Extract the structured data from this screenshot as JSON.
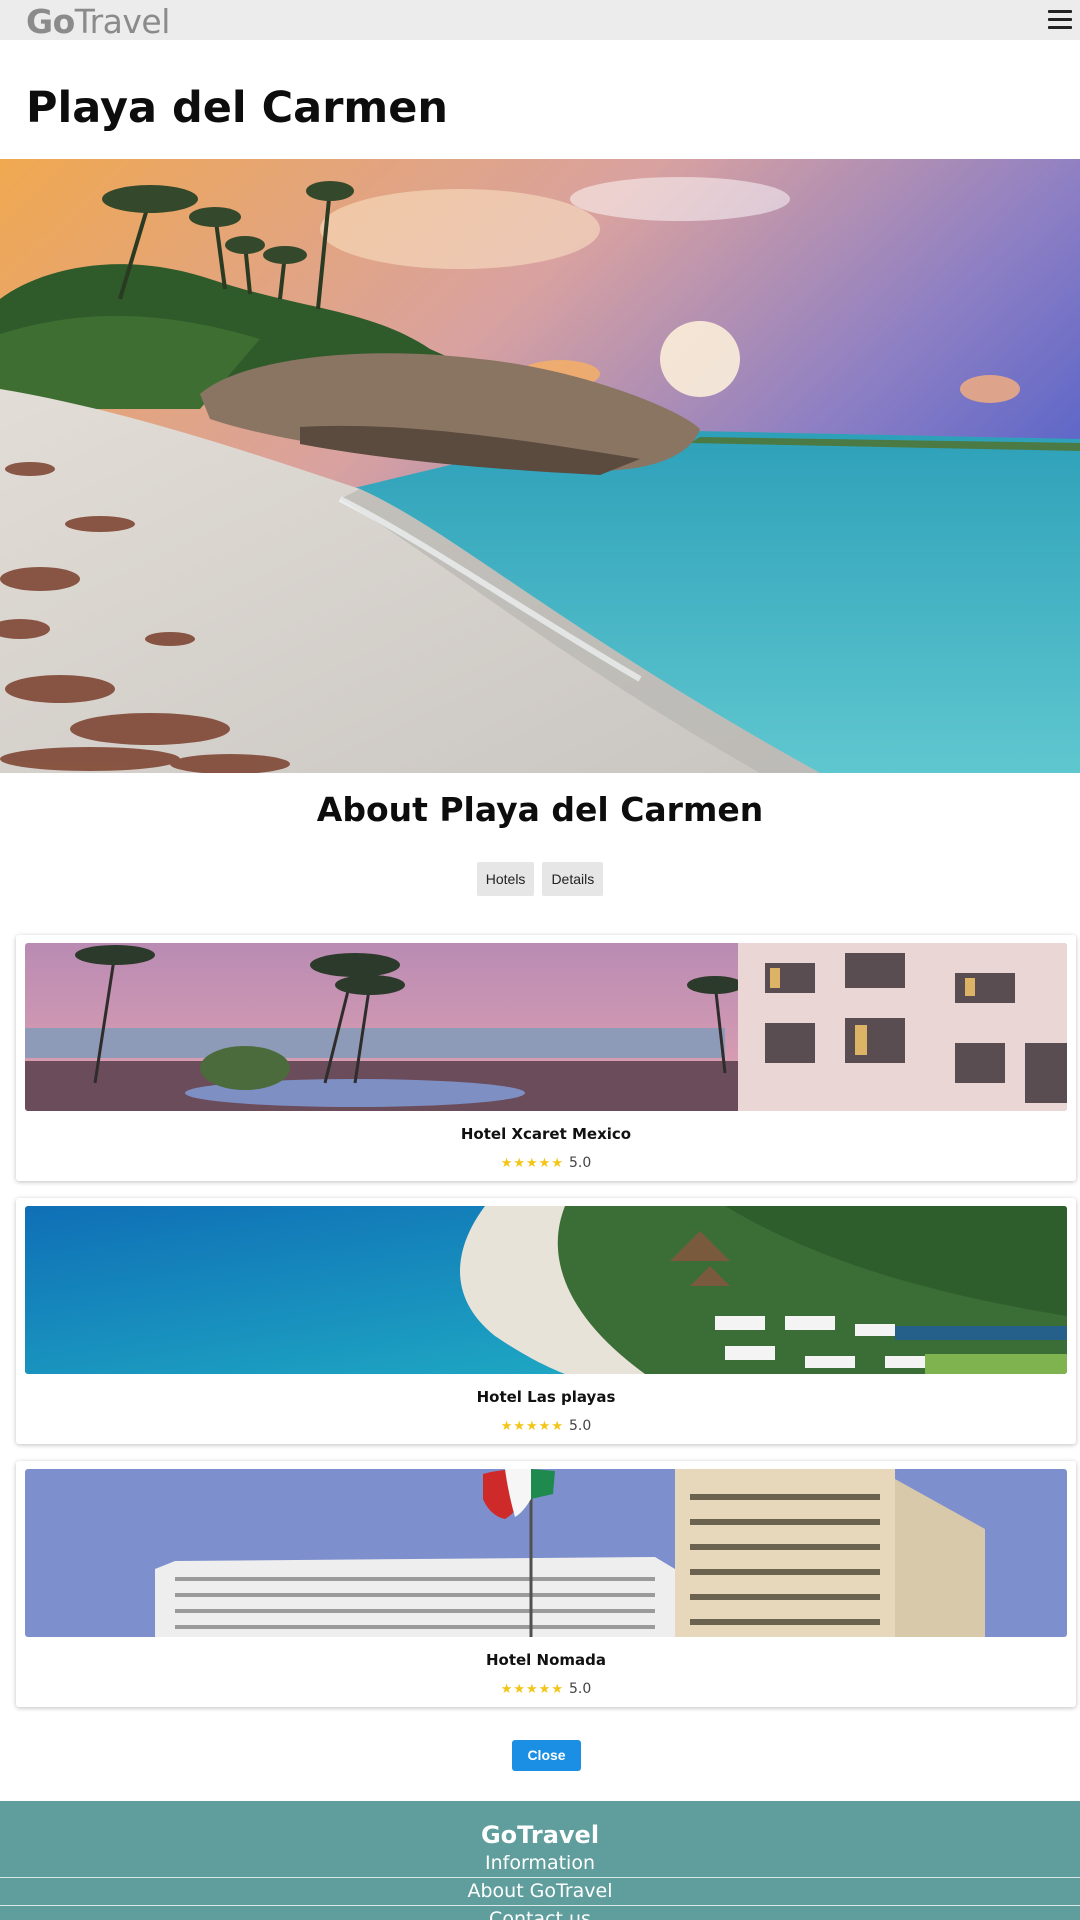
{
  "header": {
    "brand_bold": "Go",
    "brand_light": "Travel",
    "menu_icon": "hamburger-menu-icon"
  },
  "page": {
    "title": "Playa del Carmen",
    "hero_image": "beach-sunset-photo"
  },
  "about": {
    "title": "About Playa del Carmen",
    "tabs": [
      {
        "label": "Hotels"
      },
      {
        "label": "Details"
      }
    ]
  },
  "hotels": [
    {
      "name": "Hotel Xcaret Mexico",
      "stars": "★★★★★",
      "rating": "5.0",
      "image": "resort-pool-sunset-photo"
    },
    {
      "name": "Hotel Las playas",
      "stars": "★★★★★",
      "rating": "5.0",
      "image": "aerial-beach-resort-photo"
    },
    {
      "name": "Hotel Nomada",
      "stars": "★★★★★",
      "rating": "5.0",
      "image": "hotel-building-flag-photo"
    }
  ],
  "close_label": "Close",
  "footer": {
    "brand": "GoTravel",
    "links": [
      {
        "label": "Information"
      },
      {
        "label": "About GoTravel"
      },
      {
        "label": "Contact us"
      }
    ]
  },
  "colors": {
    "topbar": "#ececec",
    "accent_button": "#1a8fe3",
    "footer": "#5f9e9d",
    "star": "#f3c516"
  }
}
